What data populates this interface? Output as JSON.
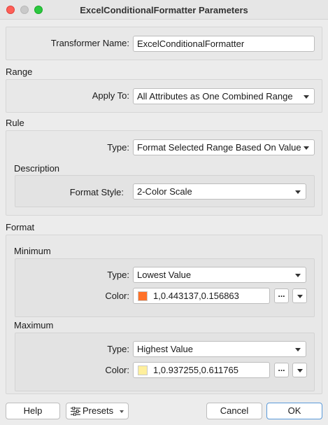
{
  "window": {
    "title": "ExcelConditionalFormatter Parameters"
  },
  "transformer": {
    "label": "Transformer Name:",
    "value": "ExcelConditionalFormatter"
  },
  "range": {
    "section": "Range",
    "apply_to_label": "Apply To:",
    "apply_to_value": "All Attributes as One Combined Range"
  },
  "rule": {
    "section": "Rule",
    "type_label": "Type:",
    "type_value": "Format Selected Range Based On Value",
    "description": {
      "section": "Description",
      "format_style_label": "Format Style:",
      "format_style_value": "2-Color Scale"
    }
  },
  "format": {
    "section": "Format",
    "minimum": {
      "section": "Minimum",
      "type_label": "Type:",
      "type_value": "Lowest Value",
      "color_label": "Color:",
      "color_value": "1,0.443137,0.156863",
      "swatch": "#ff7128"
    },
    "maximum": {
      "section": "Maximum",
      "type_label": "Type:",
      "type_value": "Highest Value",
      "color_label": "Color:",
      "color_value": "1,0.937255,0.611765",
      "swatch": "#ffef9c"
    },
    "ellipsis": "..."
  },
  "buttons": {
    "help": "Help",
    "presets": "Presets",
    "cancel": "Cancel",
    "ok": "OK"
  },
  "icons": {
    "presets": "sliders-icon",
    "dropdown": "chevron-down-icon"
  }
}
